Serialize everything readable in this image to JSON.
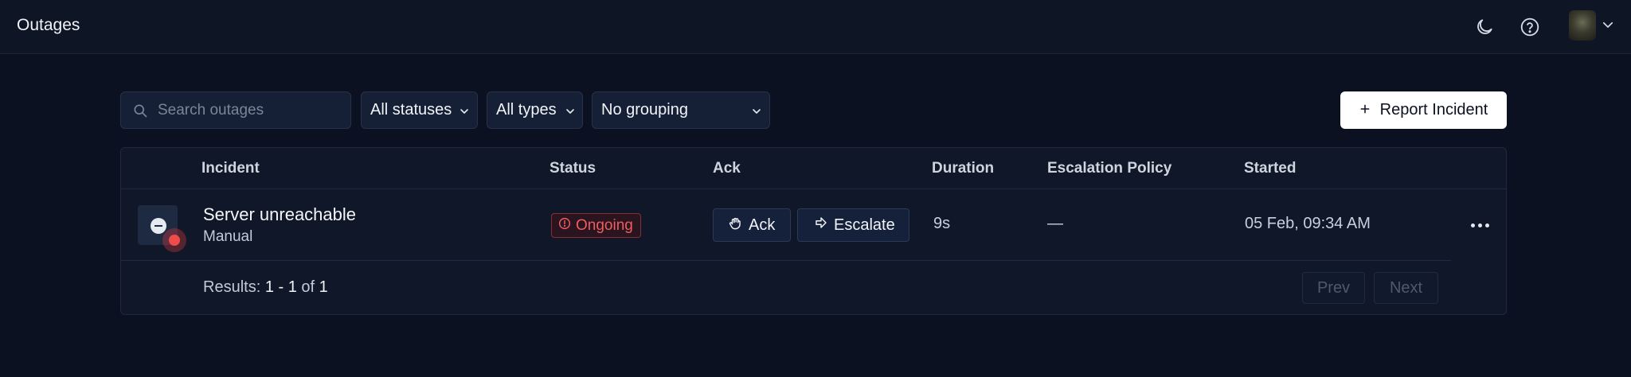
{
  "app": {
    "title": "Outages"
  },
  "header": {
    "theme_icon": "moon-icon",
    "help_icon": "help-circle-icon",
    "avatar_icon": "user-avatar"
  },
  "toolbar": {
    "search_placeholder": "Search outages",
    "search_value": "",
    "status_filter": "All statuses",
    "type_filter": "All types",
    "grouping": "No grouping",
    "report_label": "Report Incident",
    "report_icon": "plus-icon"
  },
  "table": {
    "columns": [
      "Incident",
      "Status",
      "Ack",
      "Duration",
      "Escalation Policy",
      "Started"
    ],
    "rows": [
      {
        "name": "Server unreachable",
        "type": "Manual",
        "status": "Ongoing",
        "ack_label": "Ack",
        "escalate_label": "Escalate",
        "duration": "9s",
        "escalation_policy": "—",
        "started": "05 Feb, 09:34 AM"
      }
    ]
  },
  "pagination": {
    "results_label": "Results:",
    "range": "1 - 1",
    "of_label": "of",
    "total": "1",
    "prev_label": "Prev",
    "next_label": "Next"
  },
  "colors": {
    "background": "#0b1120",
    "status_ongoing": "#ef5d5d",
    "primary_button": "#ffffff"
  }
}
